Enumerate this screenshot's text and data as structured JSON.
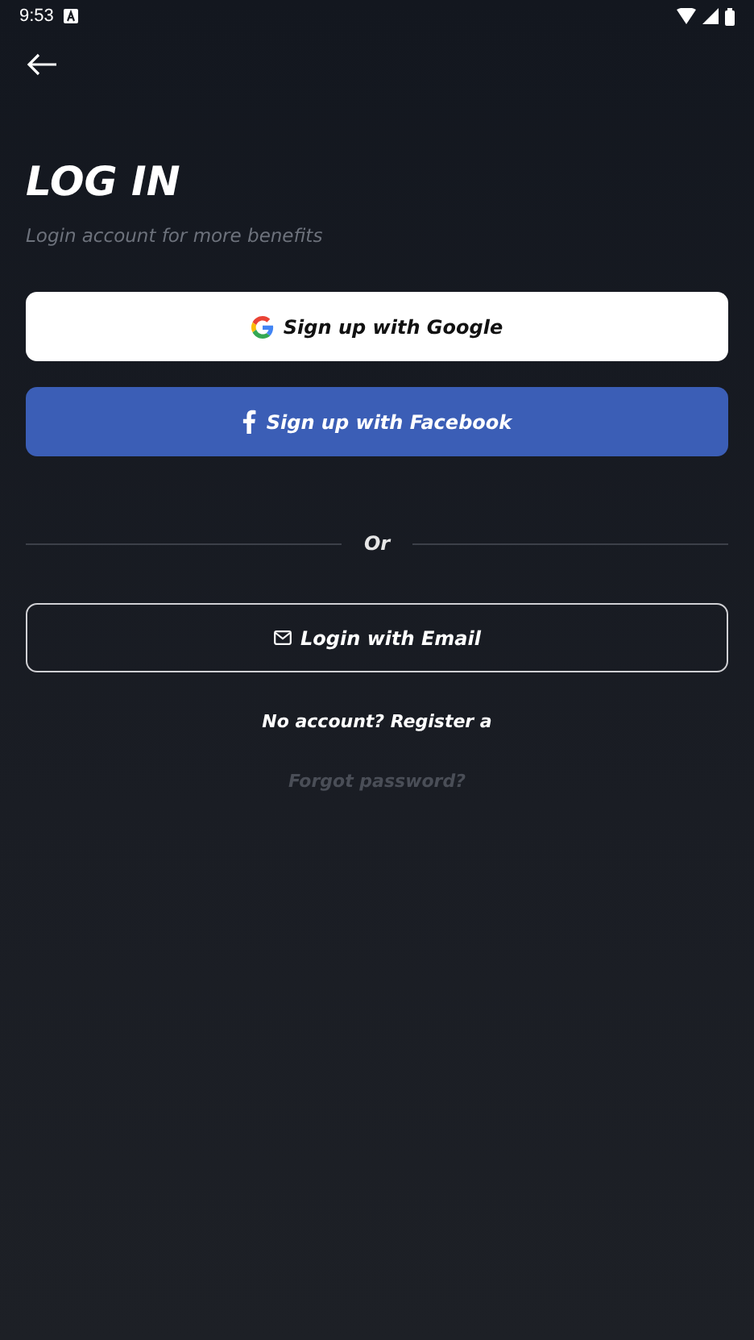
{
  "status_bar": {
    "time": "9:53"
  },
  "title": "LOG IN",
  "subtitle": "Login account for more benefits",
  "social_buttons": [
    {
      "kind": "google",
      "label": "Sign up with Google"
    },
    {
      "kind": "facebook",
      "label": "Sign up with Facebook"
    }
  ],
  "divider_label": "Or",
  "email_button": {
    "label": "Login with Email"
  },
  "register_link": "No account? Register a",
  "forgot_link": "Forgot password?"
}
